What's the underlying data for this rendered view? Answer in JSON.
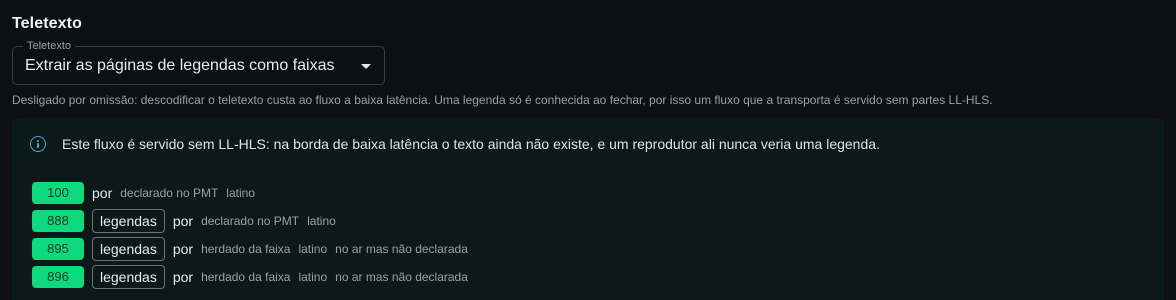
{
  "section": {
    "title": "Teletexto"
  },
  "select": {
    "legend": "Teletexto",
    "value": "Extrair as páginas de legendas como faixas"
  },
  "helper_text": "Desligado por omissão: descodificar o teletexto custa ao fluxo a baixa latência. Uma legenda só é conhecida ao fechar, por isso um fluxo que a transporta é servido sem partes LL-HLS.",
  "panel": {
    "info_text": "Este fluxo é servido sem LL-HLS: na borda de baixa latência o texto ainda não existe, e um reprodutor ali nunca veria uma legenda.",
    "rows": [
      {
        "pid": "100",
        "tag": "",
        "lang": "por",
        "meta": [
          "declarado no PMT",
          "latino"
        ]
      },
      {
        "pid": "888",
        "tag": "legendas",
        "lang": "por",
        "meta": [
          "declarado no PMT",
          "latino"
        ]
      },
      {
        "pid": "895",
        "tag": "legendas",
        "lang": "por",
        "meta": [
          "herdado da faixa",
          "latino",
          "no ar mas não declarada"
        ]
      },
      {
        "pid": "896",
        "tag": "legendas",
        "lang": "por",
        "meta": [
          "herdado da faixa",
          "latino",
          "no ar mas não declarada"
        ]
      }
    ]
  },
  "colors": {
    "background": "#0d0f12",
    "panel": "#0b1a19",
    "pid_badge": "#0fd97d",
    "info_icon": "#4aa3e6"
  },
  "icons": {
    "select_caret": "caret-down-icon",
    "info": "info-circle-icon"
  }
}
